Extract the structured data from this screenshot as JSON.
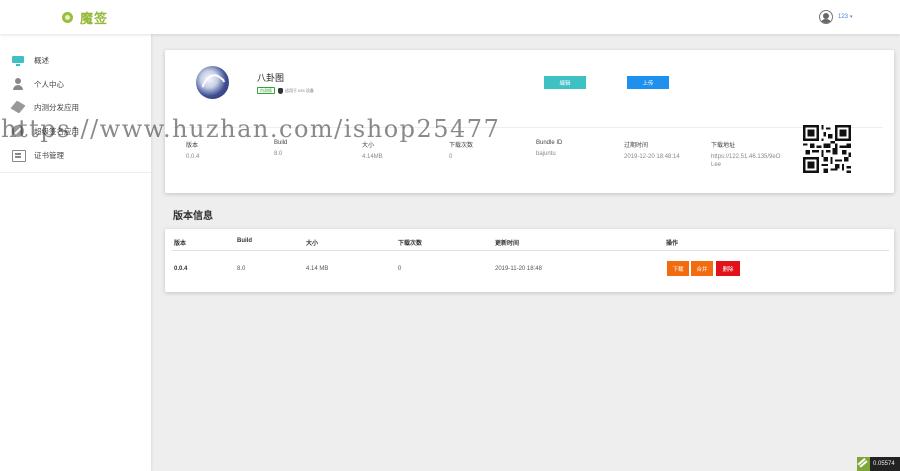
{
  "header": {
    "logo_text": "魔签",
    "user_name": "123",
    "caret": "▾"
  },
  "sidebar": {
    "items": [
      {
        "label": "概述",
        "icon": "monitor-icon"
      },
      {
        "label": "个人中心",
        "icon": "person-icon"
      },
      {
        "label": "内测分发应用",
        "icon": "box-icon"
      },
      {
        "label": "超级签名应用",
        "icon": "compass-icon"
      },
      {
        "label": "证书管理",
        "icon": "certificate-icon"
      }
    ]
  },
  "app": {
    "name": "八卦图",
    "platform_tag": "内测版",
    "device_note": "适用于 iOS 设备",
    "buttons": {
      "edit": "编辑",
      "upload": "上传"
    },
    "info": [
      {
        "key": "版本",
        "value": "0.0.4"
      },
      {
        "key": "Build",
        "value": "8.0"
      },
      {
        "key": "大小",
        "value": "4.14MB"
      },
      {
        "key": "下载次数",
        "value": "0"
      },
      {
        "key": "Bundle ID",
        "value": "bajuntu"
      },
      {
        "key": "过期时间",
        "value": "2019-12-20 18:48:14"
      },
      {
        "key": "下载地址",
        "value": "https://122.51.46.135/9eOLee"
      }
    ]
  },
  "versions": {
    "section_title": "版本信息",
    "headers": [
      "版本",
      "Build",
      "大小",
      "下载次数",
      "更新时间",
      "操作"
    ],
    "rows": [
      {
        "version": "0.0.4",
        "build": "8.0",
        "size": "4.14 MB",
        "downloads": "0",
        "updated": "2019-11-20 18:48"
      }
    ],
    "actions": {
      "download": "下载",
      "merge": "合并",
      "delete": "删除"
    }
  },
  "watermark": "https://www.huzhan.com/ishop25477",
  "corner_badge": "0.05574",
  "colors": {
    "accent_teal": "#3dc1c2",
    "accent_blue": "#1e90ee",
    "action_orange": "#f26b0f",
    "action_red": "#e2121b",
    "logo_green": "#93b83a"
  }
}
